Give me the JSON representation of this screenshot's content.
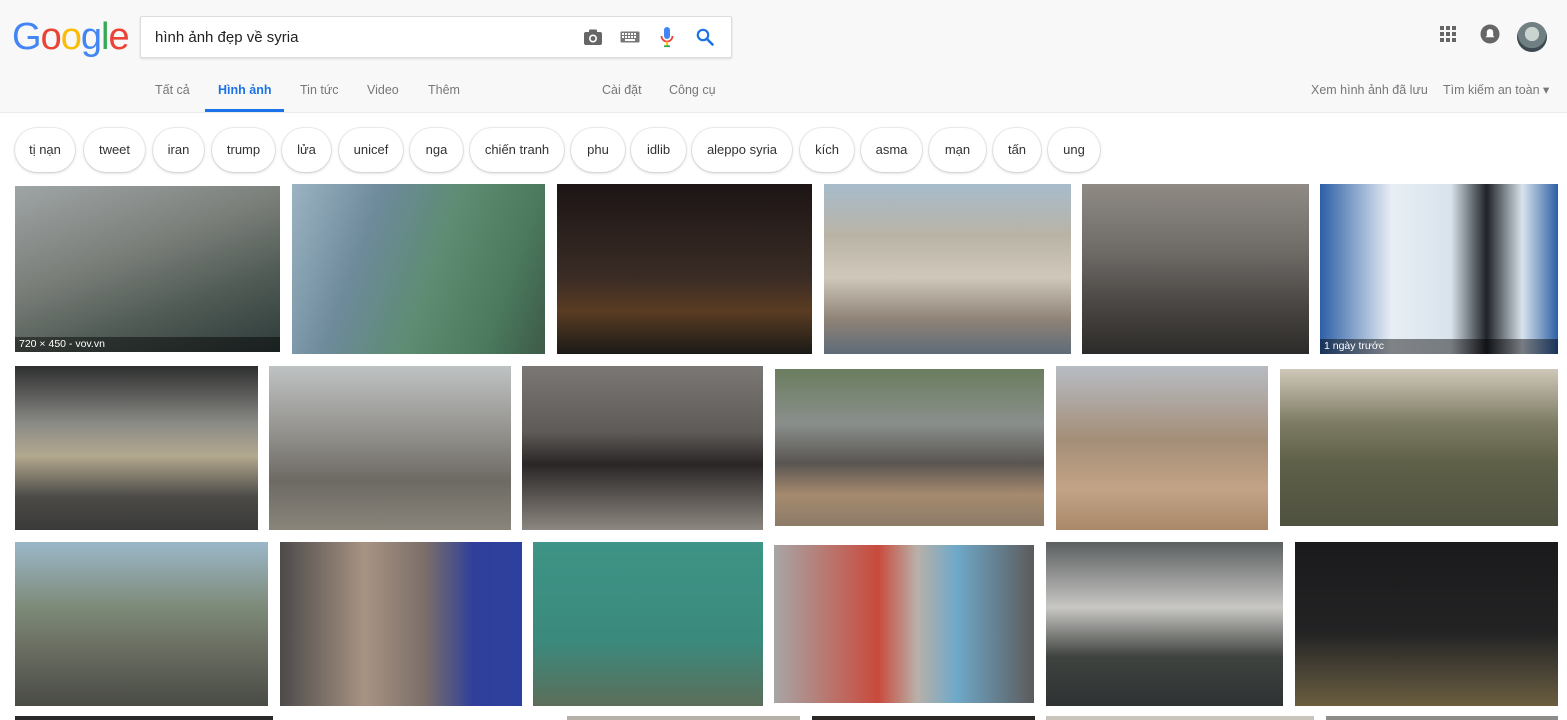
{
  "logo": {
    "text": "Google"
  },
  "search": {
    "value": "hình ảnh đẹp về syria"
  },
  "search_icons": [
    "camera-icon",
    "keyboard-icon",
    "microphone-icon",
    "search-icon"
  ],
  "header_right_icons": [
    "apps-grid-icon",
    "notifications-icon"
  ],
  "tabs": [
    {
      "label": "Tất cả"
    },
    {
      "label": "Hình ảnh",
      "active": true
    },
    {
      "label": "Tin tức"
    },
    {
      "label": "Video"
    },
    {
      "label": "Thêm"
    },
    {
      "label": "Cài đặt"
    },
    {
      "label": "Công cụ"
    }
  ],
  "right_links": {
    "saved": "Xem hình ảnh đã lưu",
    "safe_search": "Tìm kiếm an toàn ▾"
  },
  "chips": [
    "tị nạn",
    "tweet",
    "iran",
    "trump",
    "lửa",
    "unicef",
    "nga",
    "chiến tranh",
    "phu",
    "idlib",
    "aleppo syria",
    "kích",
    "asma",
    "mạn",
    "tấn",
    "ung"
  ],
  "image_captions": {
    "first": "720 × 450 - vov.vn",
    "sixth": "1 ngày trước"
  },
  "colors": {
    "accent": "#1a73e8",
    "logo_blue": "#4285f4",
    "logo_red": "#ea4335",
    "logo_yellow": "#fbbc05",
    "logo_green": "#34a853"
  }
}
